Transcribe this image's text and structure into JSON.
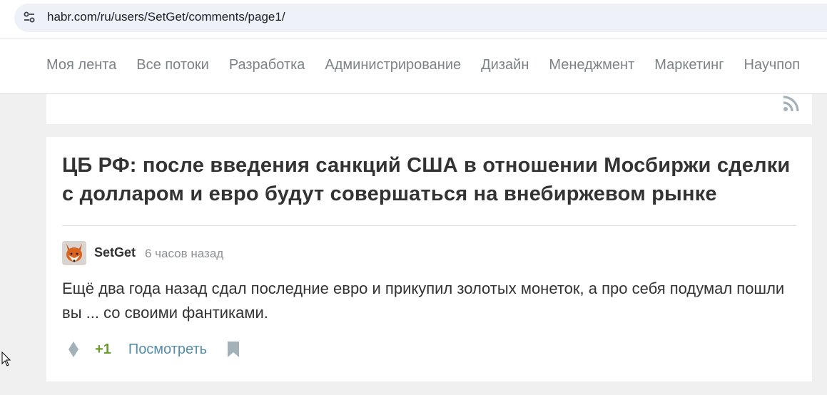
{
  "browser": {
    "url": "habr.com/ru/users/SetGet/comments/page1/",
    "site_icon": "tune-icon"
  },
  "nav": {
    "items": [
      {
        "label": "Моя лента"
      },
      {
        "label": "Все потоки"
      },
      {
        "label": "Разработка"
      },
      {
        "label": "Администрирование"
      },
      {
        "label": "Дизайн"
      },
      {
        "label": "Менеджмент"
      },
      {
        "label": "Маркетинг"
      },
      {
        "label": "Научпоп"
      }
    ]
  },
  "post": {
    "title": "ЦБ РФ: после введения санкций США в отношении Мосбиржи сделки с долларом и евро будут совершаться на внебиржевом рынке"
  },
  "comment": {
    "author": "SetGet",
    "time": "6 часов назад",
    "text": "Ещё два года назад сдал последние евро и прикупил золотых монеток, а про себя подумал пошли вы ... со своими фантиками.",
    "score": "+1",
    "view_label": "Посмотреть"
  },
  "colors": {
    "score": "#6b9d2c",
    "link": "#548eaa",
    "icon_gray": "#a3b1b8"
  }
}
